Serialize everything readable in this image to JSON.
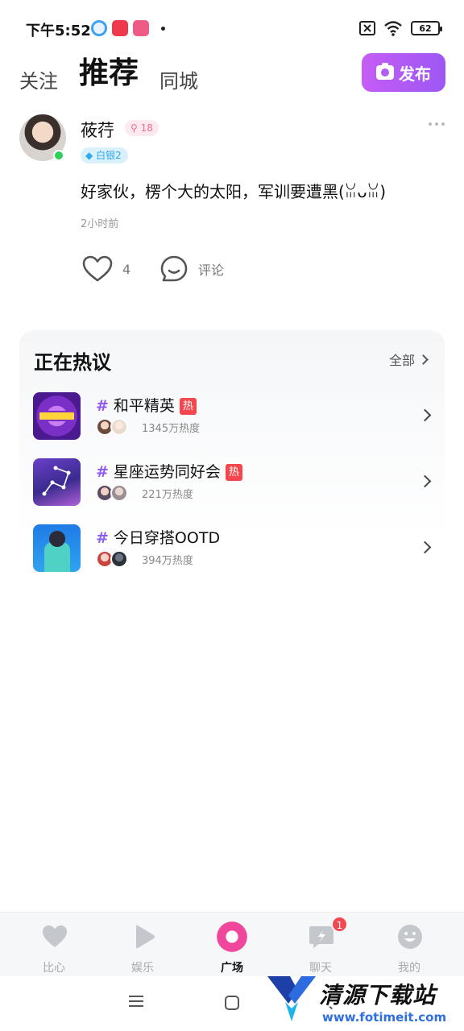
{
  "status_bar": {
    "time": "下午5:52",
    "battery": "62",
    "app_icons": [
      "cloud-app-icon",
      "red-app-icon",
      "pink-app-icon"
    ]
  },
  "header": {
    "tabs": [
      {
        "label": "关注",
        "active": false
      },
      {
        "label": "推荐",
        "active": true
      },
      {
        "label": "同城",
        "active": false
      }
    ],
    "publish_label": "发布"
  },
  "post": {
    "username": "莜荇",
    "level": "18",
    "rank": "白银2",
    "content": "好家伙，楞个大的太阳，军训要遭黑(ꈍᴗꈍ)",
    "time": "2小时前",
    "likes": "4",
    "comment_label": "评论"
  },
  "hot_topics": {
    "title": "正在热议",
    "all_label": "全部",
    "hash": "#",
    "hot_label": "热",
    "items": [
      {
        "name": "和平精英",
        "heat": "1345万热度",
        "hot": true
      },
      {
        "name": "星座运势同好会",
        "heat": "221万热度",
        "hot": true
      },
      {
        "name": "今日穿搭OOTD",
        "heat": "394万热度",
        "hot": false
      }
    ]
  },
  "bottom_nav": {
    "items": [
      {
        "label": "比心",
        "icon": "heart-icon"
      },
      {
        "label": "娱乐",
        "icon": "play-icon"
      },
      {
        "label": "广场",
        "icon": "plaza-icon",
        "active": true
      },
      {
        "label": "聊天",
        "icon": "chat-icon",
        "badge": "1"
      },
      {
        "label": "我的",
        "icon": "profile-icon"
      }
    ]
  },
  "watermark": {
    "name": "清源下载站",
    "url": "www.fotimeit.com"
  },
  "colors": {
    "accent_purple": "#a35af4",
    "plaza_pink": "#f0479c",
    "hot_red": "#f4474d",
    "online_green": "#2fcf5a"
  }
}
